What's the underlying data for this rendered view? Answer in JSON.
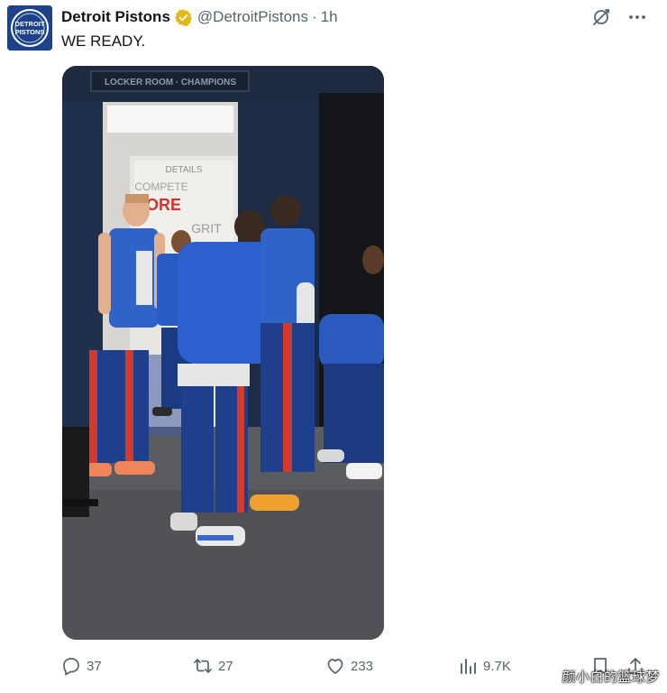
{
  "author": {
    "display_name": "Detroit Pistons",
    "handle": "@DetroitPistons",
    "separator": "·",
    "time": "1h",
    "avatar_text_line1": "DETROIT",
    "avatar_text_line2": "PISTONS"
  },
  "tweet": {
    "text": "WE READY."
  },
  "media": {
    "sign_text": "LOCKER ROOM · CHAMPIONS",
    "banner_text_1": "DETAILS",
    "banner_text_2": "COMPETE",
    "banner_text_3": "MORE",
    "banner_text_4": "GRIT"
  },
  "top_actions": {
    "grok_icon": "grok-icon",
    "more_icon": "more-icon"
  },
  "stats": {
    "replies": "37",
    "retweets": "27",
    "likes": "233",
    "views": "9.7K"
  },
  "watermark": "颜小白的篮球梦",
  "colors": {
    "verified_gold": "#e2b719",
    "pistons_blue": "#1d428a",
    "pistons_red": "#c8102e",
    "secondary_text": "#536471"
  }
}
